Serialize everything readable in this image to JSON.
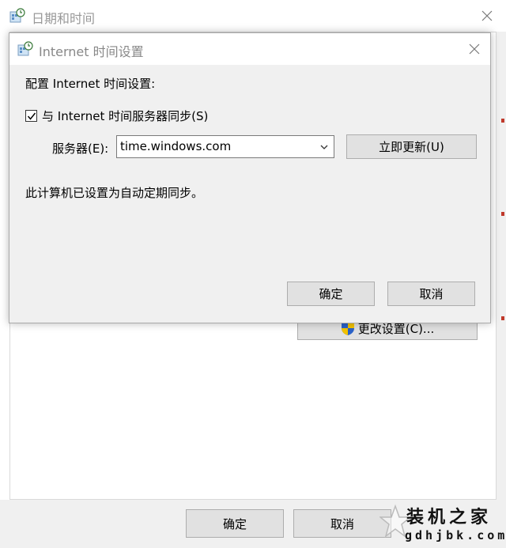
{
  "background_window": {
    "title": "日期和时间",
    "change_settings_label": "更改设置(C)...",
    "ok_label": "确定",
    "cancel_label": "取消"
  },
  "dialog": {
    "title": "Internet 时间设置",
    "heading": "配置 Internet 时间设置:",
    "sync_checkbox_label": "与 Internet 时间服务器同步(S)",
    "sync_checked": true,
    "server_label": "服务器(E):",
    "server_value": "time.windows.com",
    "update_now_label": "立即更新(U)",
    "status_text": "此计算机已设置为自动定期同步。",
    "ok_label": "确定",
    "cancel_label": "取消"
  },
  "watermark": {
    "title": "装机之家",
    "domain": "gdhjbk.com"
  },
  "icons": {
    "app": "datetime-app-icon",
    "close": "close-icon",
    "dropdown": "chevron-down-icon",
    "check": "check-icon",
    "shield": "uac-shield-icon"
  },
  "colors": {
    "window_bg": "#f0f0f0",
    "title_bg": "#ffffff",
    "button_bg": "#e1e1e1",
    "button_border": "#adadad"
  }
}
